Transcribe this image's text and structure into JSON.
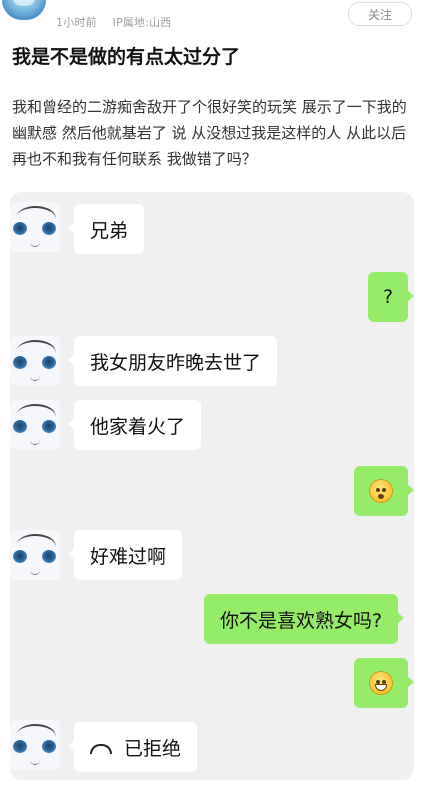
{
  "post": {
    "time": "1小时前",
    "ip_location": "IP属地:山西",
    "follow_label": "关注",
    "title": "我是不是做的有点太过分了",
    "body": "我和曾经的二游痴舍敌开了个很好笑的玩笑 展示了一下我的幽默感 然后他就基岩了 说 从没想过我是这样的人 从此以后再也不和我有任何联系 我做错了吗？"
  },
  "chat": {
    "messages": [
      {
        "side": "left",
        "text": "兄弟"
      },
      {
        "side": "right",
        "text": "?"
      },
      {
        "side": "left",
        "text": "我女朋友昨晚去世了"
      },
      {
        "side": "left",
        "text": "他家着火了"
      },
      {
        "side": "right",
        "emoji": "dizzy-face-icon"
      },
      {
        "side": "left",
        "text": "好难过啊"
      },
      {
        "side": "right",
        "text": "你不是喜欢熟女吗?"
      },
      {
        "side": "right",
        "emoji": "grinning-face-icon"
      },
      {
        "side": "left",
        "icon": "hang-up-phone-icon",
        "text": "已拒绝"
      }
    ]
  }
}
